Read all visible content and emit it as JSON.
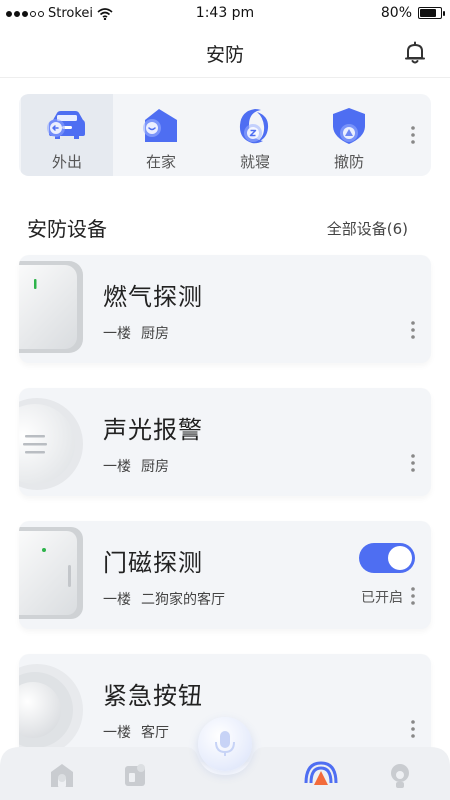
{
  "status_bar": {
    "carrier": "Strokei",
    "time": "1:43 pm",
    "battery": "80%",
    "battery_level": 0.8
  },
  "nav": {
    "title": "安防",
    "icon": "bell-icon"
  },
  "modes": [
    {
      "label": "外出",
      "icon": "car-icon",
      "active": true
    },
    {
      "label": "在家",
      "icon": "home-icon",
      "active": false
    },
    {
      "label": "就寝",
      "icon": "moon-icon",
      "active": false
    },
    {
      "label": "撤防",
      "icon": "shield-icon",
      "active": false
    }
  ],
  "section": {
    "title": "安防设备",
    "all_devices": "全部设备(6)"
  },
  "devices": [
    {
      "name": "燃气探测",
      "floor": "一楼",
      "room": "厨房",
      "status": "",
      "has_toggle": false
    },
    {
      "name": "声光报警",
      "floor": "一楼",
      "room": "厨房",
      "status": "",
      "has_toggle": false
    },
    {
      "name": "门磁探测",
      "floor": "一楼",
      "room": "二狗家的客厅",
      "status": "已开启",
      "has_toggle": true,
      "toggle_on": true
    },
    {
      "name": "紧急按钮",
      "floor": "一楼",
      "room": "客厅",
      "status": "",
      "has_toggle": false
    }
  ],
  "tab_bar": {
    "tabs": [
      {
        "icon": "home-icon"
      },
      {
        "icon": "scene-icon"
      },
      {
        "icon": "security-icon",
        "active": true
      },
      {
        "icon": "profile-icon"
      }
    ],
    "center": {
      "icon": "microphone-icon"
    }
  },
  "colors": {
    "accent": "#4e6ef2",
    "active_orange": "#f26b3a",
    "card_bg": "#f3f5f8"
  }
}
